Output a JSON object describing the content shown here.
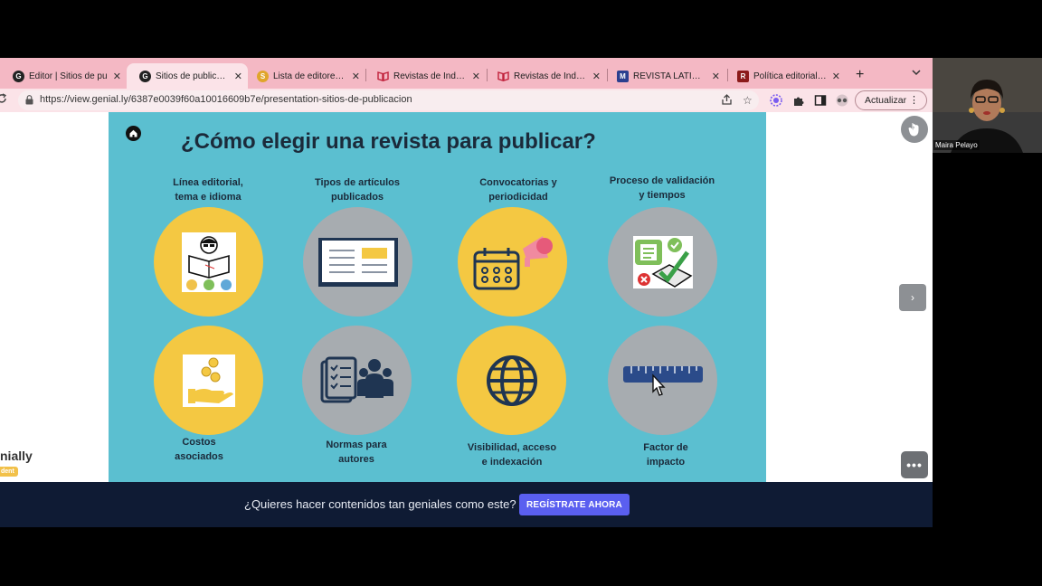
{
  "browser": {
    "tabs": [
      {
        "title": "Editor | Sitios de pu",
        "icon": "genially-icon",
        "active": false
      },
      {
        "title": "Sitios de publicación",
        "icon": "genially-icon",
        "active": true
      },
      {
        "title": "Lista de editores - S",
        "icon": "sherpa-icon",
        "active": false
      },
      {
        "title": "Revistas de Indexad",
        "icon": "book-icon",
        "active": false
      },
      {
        "title": "Revistas de Indexad",
        "icon": "book-icon",
        "active": false
      },
      {
        "title": "REVISTA LATINOAM",
        "icon": "m-icon",
        "active": false
      },
      {
        "title": "Política editorial | R",
        "icon": "r-icon",
        "active": false
      }
    ],
    "close_glyph": "✕",
    "newtab_glyph": "+",
    "url": "https://view.genial.ly/6387e0039f60a10016609b7e/presentation-sitios-de-publicacion",
    "update_label": "Actualizar"
  },
  "slide": {
    "title": "¿Cómo elegir una  revista para publicar?",
    "top_row": [
      {
        "label": "Línea editorial,\ntema e idioma",
        "color": "yellow",
        "icon": "reading-person-icon"
      },
      {
        "label": "Tipos de artículos\npublicados",
        "color": "grey",
        "icon": "document-icon"
      },
      {
        "label": "Convocatorias y\nperiodicidad",
        "color": "yellow",
        "icon": "calendar-megaphone-icon"
      },
      {
        "label": "Proceso de validación\ny tiempos",
        "color": "grey",
        "icon": "checklist-icon"
      }
    ],
    "bottom_row": [
      {
        "label": "Costos\nasociados",
        "color": "yellow",
        "icon": "coins-hand-icon"
      },
      {
        "label": "Normas para\nautores",
        "color": "grey",
        "icon": "rules-people-icon"
      },
      {
        "label": "Visibilidad, acceso\ne indexación",
        "color": "yellow",
        "icon": "globe-icon"
      },
      {
        "label": "Factor de\nimpacto",
        "color": "grey",
        "icon": "ruler-icon"
      }
    ]
  },
  "brand": {
    "name": "nially",
    "badge": "dent"
  },
  "banner": {
    "text": "¿Quieres hacer contenidos tan geniales como este?",
    "cta": "REGÍSTRATE AHORA"
  },
  "webcam": {
    "name": "Maira Pelayo"
  },
  "colors": {
    "tabstrip": "#f4b8c4",
    "slide_bg": "#5bbfd0",
    "yellow": "#f4c842",
    "grey": "#a7acb0",
    "banner": "#0f1b34",
    "cta": "#5a5ff0"
  }
}
